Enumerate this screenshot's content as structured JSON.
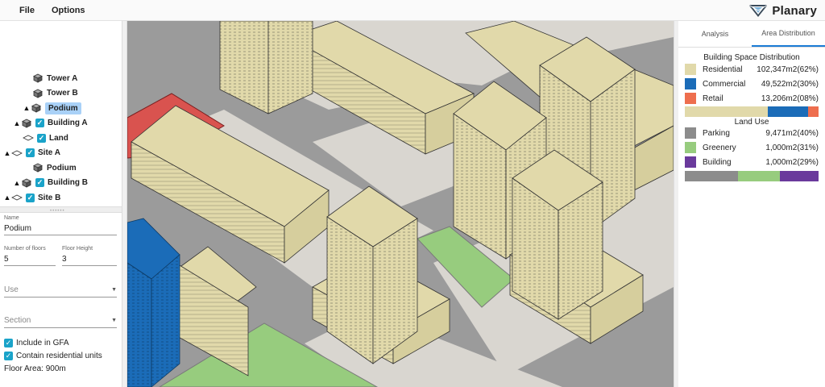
{
  "menu": {
    "file": "File",
    "options": "Options"
  },
  "brand": {
    "name": "Planary",
    "icon": "planary-logo-icon"
  },
  "tree": [
    {
      "label": "Tower A",
      "indent": 3,
      "caret": false,
      "checkbox": false,
      "icon": "cube-icon",
      "selected": false
    },
    {
      "label": "Tower B",
      "indent": 3,
      "caret": false,
      "checkbox": false,
      "icon": "cube-icon",
      "selected": false
    },
    {
      "label": "Podium",
      "indent": 2,
      "caret": true,
      "checkbox": false,
      "icon": "cube-icon",
      "selected": true
    },
    {
      "label": "Building A",
      "indent": 1,
      "caret": true,
      "checkbox": true,
      "icon": "cube-icon",
      "selected": false
    },
    {
      "label": "Land",
      "indent": 2,
      "caret": false,
      "checkbox": true,
      "icon": "plane-icon",
      "selected": false
    },
    {
      "label": "Site A",
      "indent": 0,
      "caret": true,
      "checkbox": true,
      "icon": "plane-icon",
      "selected": false
    },
    {
      "label": "Podium",
      "indent": 3,
      "caret": false,
      "checkbox": false,
      "icon": "cube-icon",
      "selected": false
    },
    {
      "label": "Building B",
      "indent": 1,
      "caret": true,
      "checkbox": true,
      "icon": "cube-icon",
      "selected": false
    },
    {
      "label": "Site B",
      "indent": 0,
      "caret": true,
      "checkbox": true,
      "icon": "plane-icon",
      "selected": false
    }
  ],
  "properties": {
    "name_label": "Name",
    "name_value": "Podium",
    "floors_label": "Number of floors",
    "floors_value": "5",
    "height_label": "Floor Height",
    "height_value": "3",
    "use_placeholder": "Use",
    "section_placeholder": "Section",
    "include_gfa": "Include in GFA",
    "contain_residential": "Contain residential units",
    "floor_area": "Floor Area: 900m"
  },
  "tabs": {
    "analysis": "Analysis",
    "area_distribution": "Area Distribution"
  },
  "space_distribution": {
    "title": "Building Space Distribution",
    "items": [
      {
        "name": "Residential",
        "value": "102,347m2(62%)",
        "color": "#e1d9aa",
        "percent": 62
      },
      {
        "name": "Commercial",
        "value": "49,522m2(30%)",
        "color": "#1b6cb8",
        "percent": 30
      },
      {
        "name": "Retail",
        "value": "13,206m2(08%)",
        "color": "#ee6e4e",
        "percent": 8
      }
    ]
  },
  "land_use": {
    "title": "Land Use",
    "items": [
      {
        "name": "Parking",
        "value": "9,471m2(40%)",
        "color": "#8c8c8c",
        "percent": 40
      },
      {
        "name": "Greenery",
        "value": "1,000m2(31%)",
        "color": "#97cc7e",
        "percent": 31
      },
      {
        "name": "Building",
        "value": "1,000m2(29%)",
        "color": "#6a3a9c",
        "percent": 29
      }
    ]
  },
  "colors": {
    "accent": "#1c7cd5",
    "checkbox": "#1aa3c9",
    "selection": "#a9d1f7",
    "building": "#e1d9aa",
    "road": "#9a9a9a",
    "greenery": "#97cc7e",
    "retail": "#d9534f",
    "commercial": "#1b6cb8"
  }
}
